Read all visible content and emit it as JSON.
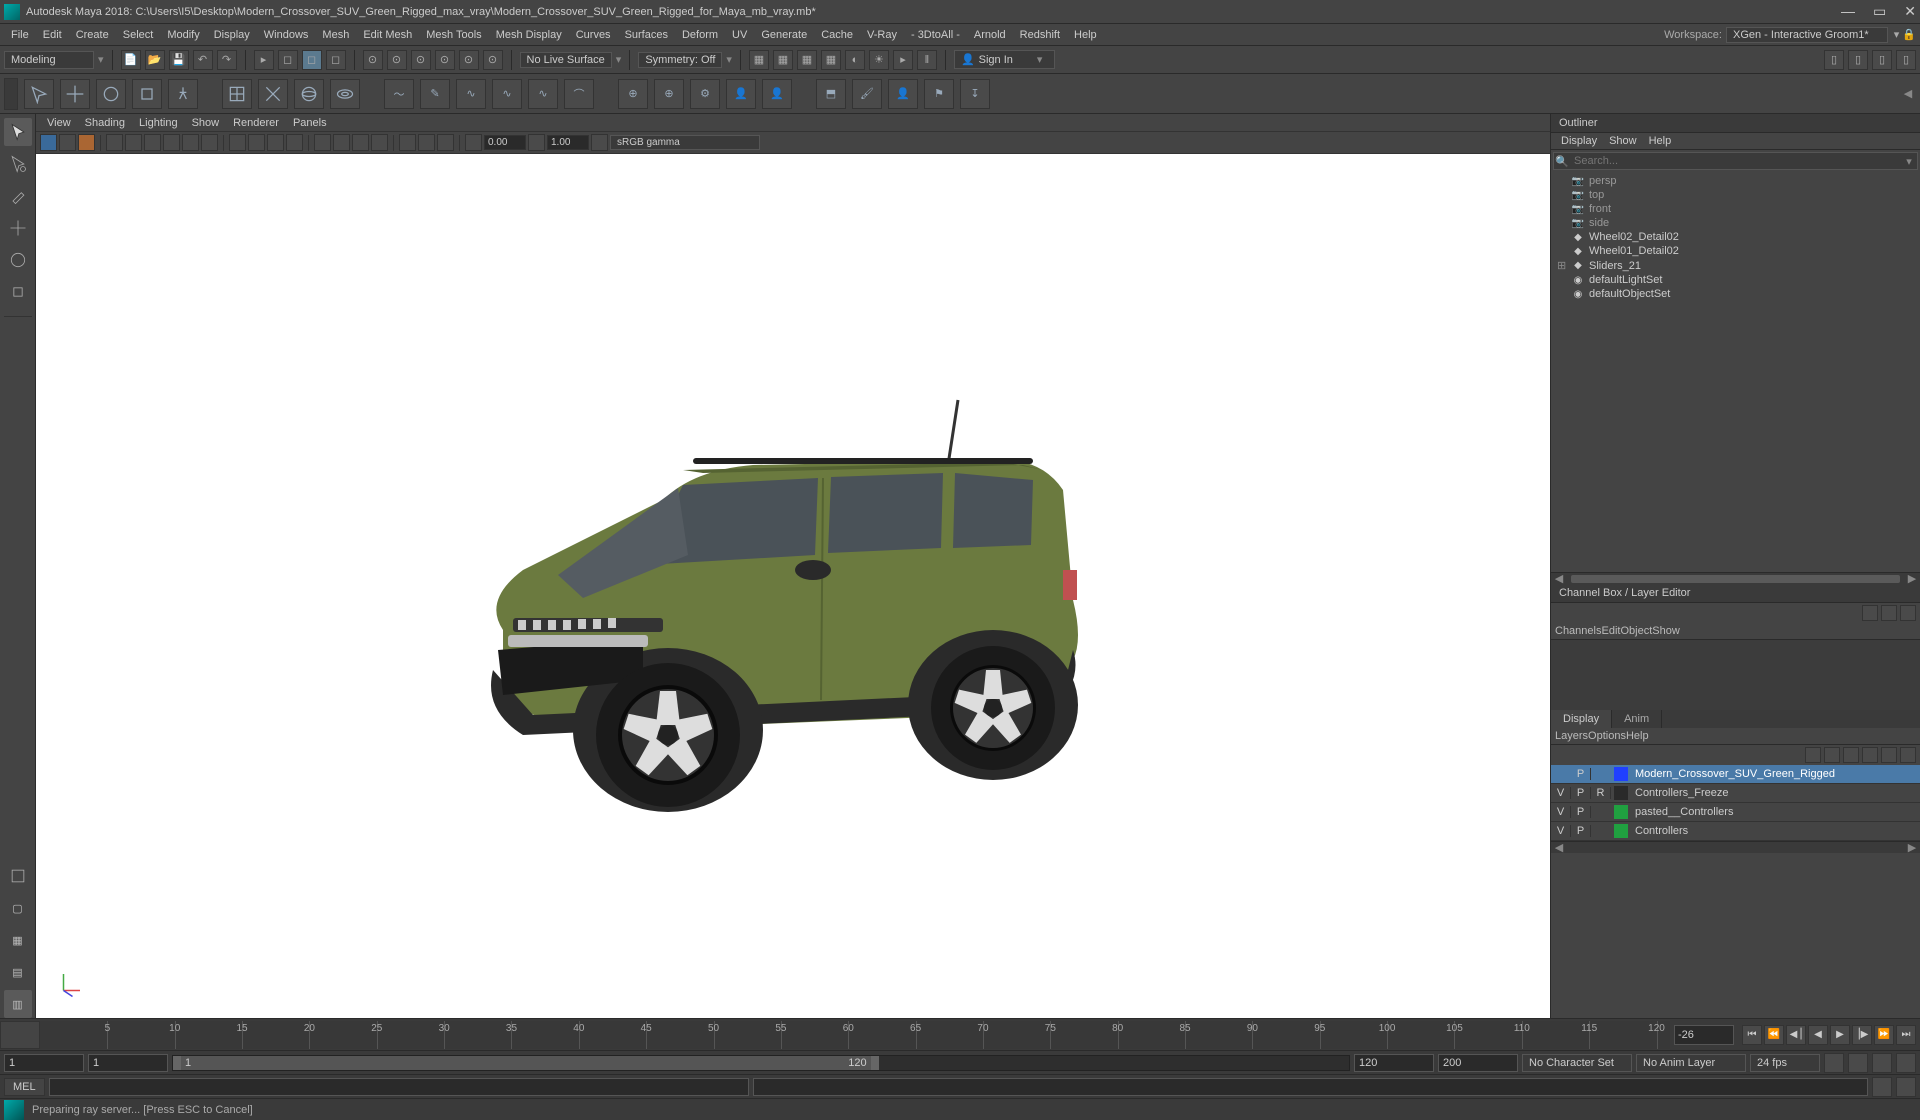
{
  "titlebar": {
    "title": "Autodesk Maya 2018: C:\\Users\\I5\\Desktop\\Modern_Crossover_SUV_Green_Rigged_max_vray\\Modern_Crossover_SUV_Green_Rigged_for_Maya_mb_vray.mb*"
  },
  "menubar": {
    "items": [
      "File",
      "Edit",
      "Create",
      "Select",
      "Modify",
      "Display",
      "Windows",
      "Mesh",
      "Edit Mesh",
      "Mesh Tools",
      "Mesh Display",
      "Curves",
      "Surfaces",
      "Deform",
      "UV",
      "Generate",
      "Cache",
      "V-Ray",
      "- 3DtoAll -",
      "Arnold",
      "Redshift",
      "Help"
    ],
    "workspace_label": "Workspace:",
    "workspace_value": "XGen - Interactive Groom1*"
  },
  "shelf": {
    "mode": "Modeling",
    "live_surface": "No Live Surface",
    "symmetry": "Symmetry: Off",
    "signin": "Sign In"
  },
  "viewport_menu": [
    "View",
    "Shading",
    "Lighting",
    "Show",
    "Renderer",
    "Panels"
  ],
  "viewport_toolbar": {
    "num1": "0.00",
    "num2": "1.00",
    "colorspace": "sRGB gamma"
  },
  "outliner": {
    "title": "Outliner",
    "menus": [
      "Display",
      "Show",
      "Help"
    ],
    "search_placeholder": "Search...",
    "nodes": [
      {
        "label": "persp",
        "type": "cam",
        "dim": true
      },
      {
        "label": "top",
        "type": "cam",
        "dim": true
      },
      {
        "label": "front",
        "type": "cam",
        "dim": true
      },
      {
        "label": "side",
        "type": "cam",
        "dim": true
      },
      {
        "label": "Wheel02_Detail02",
        "type": "mesh",
        "dim": false
      },
      {
        "label": "Wheel01_Detail02",
        "type": "mesh",
        "dim": false
      },
      {
        "label": "Sliders_21",
        "type": "mesh",
        "dim": false,
        "expandable": true
      },
      {
        "label": "defaultLightSet",
        "type": "set",
        "dim": false
      },
      {
        "label": "defaultObjectSet",
        "type": "set",
        "dim": false
      }
    ]
  },
  "channelbox": {
    "title": "Channel Box / Layer Editor",
    "menus": [
      "Channels",
      "Edit",
      "Object",
      "Show"
    ]
  },
  "layers": {
    "tabs": [
      "Display",
      "Anim"
    ],
    "menus": [
      "Layers",
      "Options",
      "Help"
    ],
    "rows": [
      {
        "v": "",
        "p": "P",
        "r": "",
        "color": "#2040ff",
        "name": "Modern_Crossover_SUV_Green_Rigged",
        "selected": true
      },
      {
        "v": "V",
        "p": "P",
        "r": "R",
        "color": "#2a2a2a",
        "name": "Controllers_Freeze"
      },
      {
        "v": "V",
        "p": "P",
        "r": "",
        "color": "#20a040",
        "name": "pasted__Controllers"
      },
      {
        "v": "V",
        "p": "P",
        "r": "",
        "color": "#20a040",
        "name": "Controllers"
      }
    ]
  },
  "timeline": {
    "ticks": [
      "5",
      "10",
      "15",
      "20",
      "25",
      "30",
      "35",
      "40",
      "45",
      "50",
      "55",
      "60",
      "65",
      "70",
      "75",
      "80",
      "85",
      "90",
      "95",
      "100",
      "105",
      "110",
      "115",
      "120"
    ],
    "current": "-26"
  },
  "range": {
    "start_outer": "1",
    "start_inner": "1",
    "inner_label": "1",
    "inner_end": "120",
    "end_inner": "120",
    "end_outer": "200",
    "charset": "No Character Set",
    "animlayer": "No Anim Layer",
    "fps": "24 fps"
  },
  "cmd": {
    "label": "MEL"
  },
  "status": {
    "text": "Preparing ray server... [Press ESC to Cancel]"
  }
}
